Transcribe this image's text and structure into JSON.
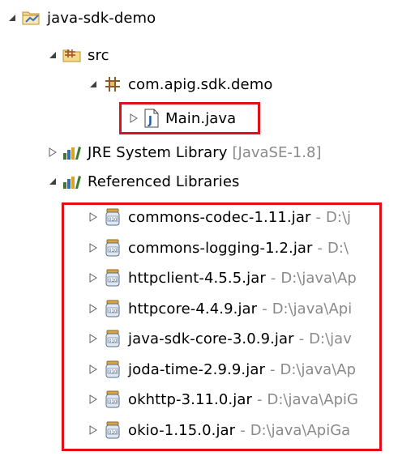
{
  "tree": {
    "project": {
      "label": "java-sdk-demo"
    },
    "src": {
      "label": "src"
    },
    "package": {
      "label": "com.apig.sdk.demo"
    },
    "main_file": {
      "label": "Main.java"
    },
    "jre": {
      "label": "JRE System Library",
      "decoration": "[JavaSE-1.8]"
    },
    "ref_libs": {
      "label": "Referenced Libraries"
    },
    "jars": [
      {
        "name": "commons-codec-1.11.jar",
        "path": "D:\\j"
      },
      {
        "name": "commons-logging-1.2.jar",
        "path": "D:\\"
      },
      {
        "name": "httpclient-4.5.5.jar",
        "path": "D:\\java\\Ap"
      },
      {
        "name": "httpcore-4.4.9.jar",
        "path": "D:\\java\\Api"
      },
      {
        "name": "java-sdk-core-3.0.9.jar",
        "path": "D:\\jav"
      },
      {
        "name": "joda-time-2.9.9.jar",
        "path": "D:\\java\\Ap"
      },
      {
        "name": "okhttp-3.11.0.jar",
        "path": "D:\\java\\ApiG"
      },
      {
        "name": "okio-1.15.0.jar",
        "path": "D:\\java\\ApiGa"
      }
    ],
    "dash": "-"
  },
  "colors": {
    "highlight": "#e0101a",
    "decoration_text": "#8a8a8a",
    "jre_icon": "#3c7a2e"
  }
}
